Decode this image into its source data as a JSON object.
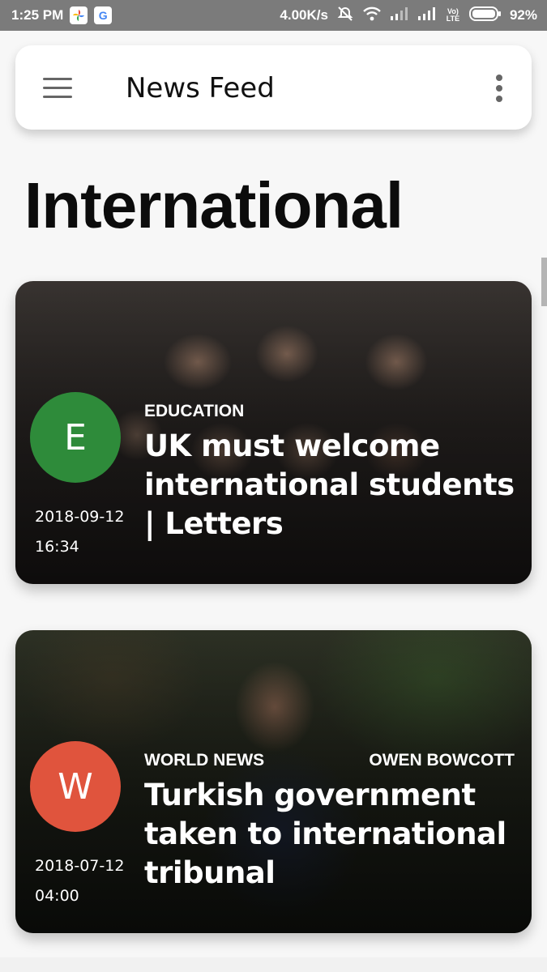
{
  "status_bar": {
    "time": "1:25 PM",
    "speed": "4.00K/s",
    "battery": "92%",
    "app_icons": [
      "photos-icon",
      "google-icon"
    ],
    "indicators": [
      "mute-icon",
      "wifi-icon",
      "signal-icon",
      "signal-icon",
      "volte-icon",
      "battery-icon"
    ],
    "volte": "Vo) LTE"
  },
  "appbar": {
    "title": "News Feed"
  },
  "page": {
    "section_title": "International"
  },
  "articles": [
    {
      "avatar_letter": "E",
      "avatar_color": "#2e8b3a",
      "category": "EDUCATION",
      "author": "",
      "headline": "UK must welcome international students | Letters",
      "date": "2018-09-12",
      "time": "16:34"
    },
    {
      "avatar_letter": "W",
      "avatar_color": "#e0543d",
      "category": "WORLD NEWS",
      "author": "OWEN BOWCOTT",
      "headline": "Turkish government taken to international tribunal",
      "date": "2018-07-12",
      "time": "04:00"
    }
  ],
  "colors": {
    "background": "#f7f7f7",
    "status_bar": "#7b7b7b"
  }
}
